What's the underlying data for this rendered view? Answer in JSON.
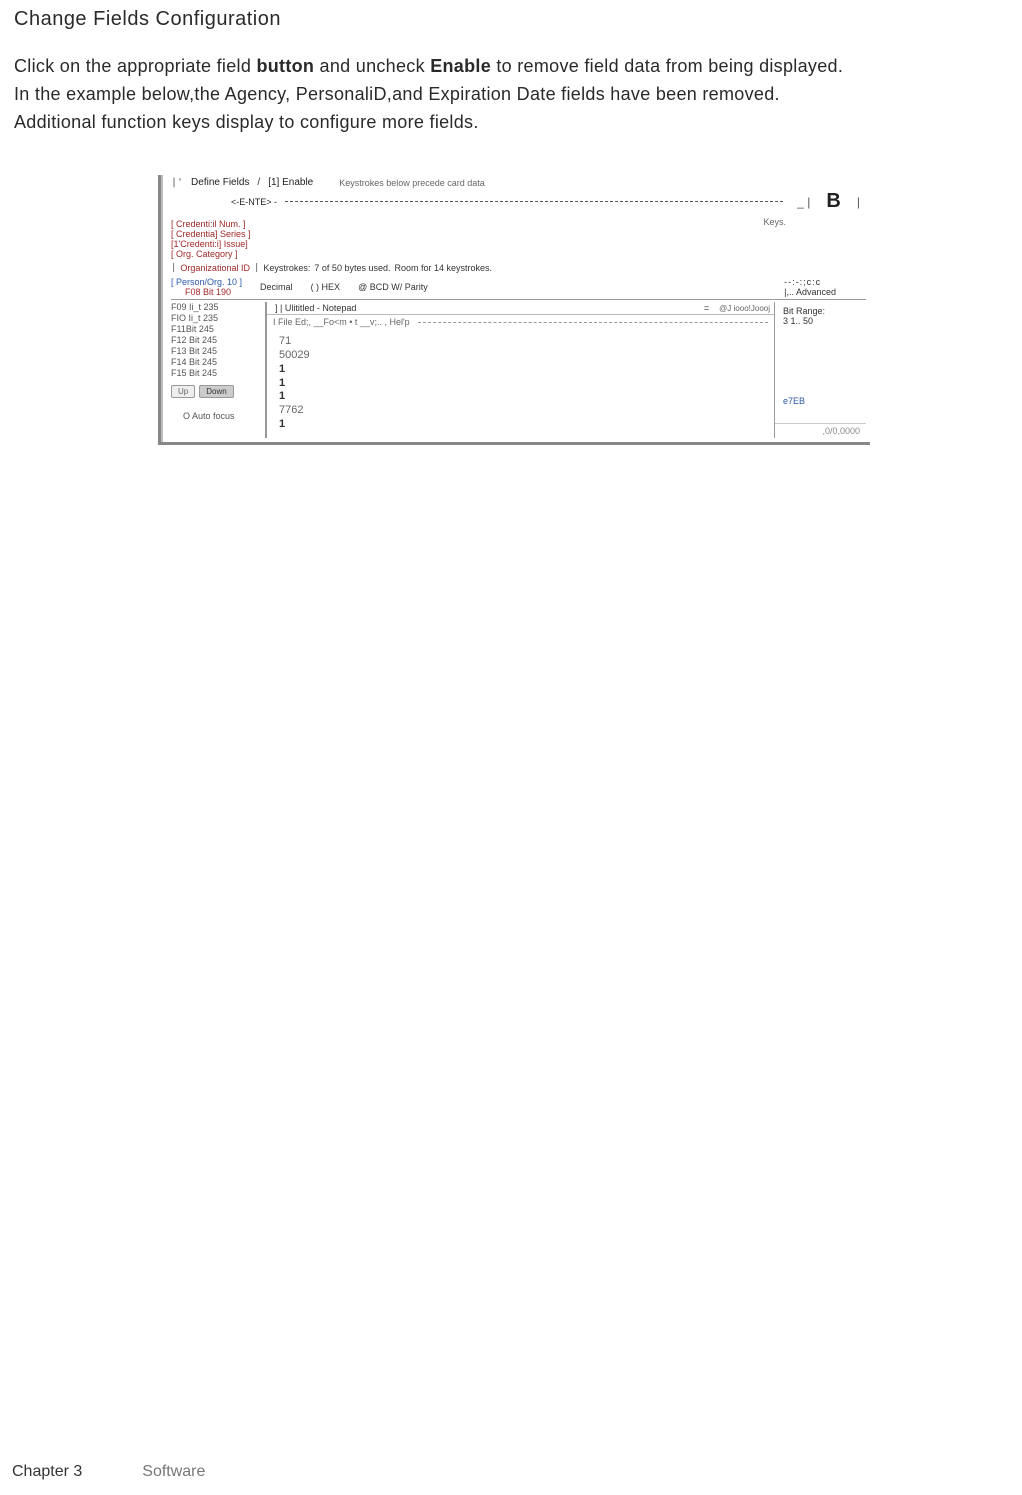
{
  "title": "Change Fields Configuration",
  "body1_a": "Click on the appropriate field ",
  "body1_b": "button",
  "body1_c": " and uncheck ",
  "body1_d": "Enable",
  "body1_e": " to remove  field data from  being displayed.",
  "body2": "In the example  below,the Agency, PersonaliD,and Expiration  Date fields have been removed.",
  "body3": "Additional function keys display  to configure  more  fields.",
  "ss": {
    "define_fields": "Define Fields",
    "slash": "/",
    "enable": "[1] Enable",
    "ks_hdr": "Keystrokes below precede card data",
    "enter": "<-E-NTE> -",
    "big_b": "B",
    "keys_label": "Keys.",
    "buttons": [
      {
        "label": "[ Credenti:il Num.  ]",
        "cls": ""
      },
      {
        "label": "[ Credentia] Series ]",
        "cls": ""
      },
      {
        "label": "[1'Credenti:i] Issue]",
        "cls": ""
      },
      {
        "label": "[   Org. Category   ]",
        "cls": ""
      }
    ],
    "org_id": "Organizational ID",
    "ks2_a": "Keystrokes:",
    "ks2_b": "7 of 50 bytes used.",
    "ks2_c": "Room for 14 keystrokes.",
    "person_org": "[  Person/Org. 10  ]",
    "cc": "--:-:;c:c",
    "f08": "F08  Bit 190",
    "decimal": "Decimal",
    "hex": "( ) HEX",
    "bcd": "@  BCD W/ Parity",
    "adv": "|,.. Advanced",
    "left_lines": [
      "F09 Ii_t 235",
      "FIO Ii_t 235",
      "F11Bit 245",
      "F12 Bit 245",
      "F13  Bit 245",
      "F14  Bit 245",
      "F15 Bit 245"
    ],
    "up": "Up",
    "down": "Down",
    "auto_focus": "O Auto focus",
    "np_title": "] | Ulititled - Notepad",
    "np_eq": "=",
    "np_j": "@J  iooo!Joooj",
    "np_menu": "I File   Ed;,  __Fo<m • t  __v;.. ,   Hel'p",
    "np_lines": [
      "71",
      "50029",
      "1",
      "1",
      "1",
      "7762",
      "1"
    ],
    "bit_range_label": "Bit Range:",
    "bit_range_val": "3 1.. 50",
    "e7": "e7EB",
    "zeros": ",0/0,0000"
  },
  "footer": {
    "chapter": "Chapter 3",
    "soft": "Software"
  }
}
